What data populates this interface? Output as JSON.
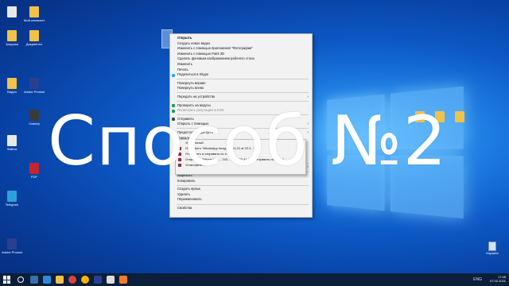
{
  "overlay_title": "Способ №2",
  "context_menu": {
    "items": [
      {
        "label": "Открыть",
        "bold": true
      },
      {
        "label": "Создать новое видео"
      },
      {
        "label": "Изменить с помощью приложения \"Фотографии\""
      },
      {
        "label": "Изменить с помощью Paint 3D"
      },
      {
        "label": "Сделать фоновым изображением рабочего стола"
      },
      {
        "label": "Изменить"
      },
      {
        "label": "Печать"
      },
      {
        "label": "Поделиться в Skype",
        "icon": "skype-icon"
      },
      {
        "sep": true
      },
      {
        "label": "Повернуть вправо"
      },
      {
        "label": "Повернуть влево"
      },
      {
        "sep": true
      },
      {
        "label": "Передать на устройство",
        "submenu": true
      },
      {
        "sep": true
      },
      {
        "label": "Проверить на вирусы",
        "icon": "kaspersky-icon"
      },
      {
        "label": "Посмотреть репутацию в KSN",
        "icon": "kaspersky-icon",
        "disabled": true
      },
      {
        "sep": true
      },
      {
        "label": "Отправить",
        "icon": "share-icon"
      },
      {
        "label": "Открыть с помощью",
        "submenu": true
      },
      {
        "sep": true
      },
      {
        "label": "Предоставить доступ к",
        "submenu": true
      },
      {
        "label": "Уникальный"
      },
      {
        "label": "Отправить"
      },
      {
        "label": "Отправить"
      },
      {
        "label": "Отправить"
      },
      {
        "label": "Отправить"
      },
      {
        "sep": true
      },
      {
        "label": "Отправить",
        "submenu": true
      },
      {
        "sep": true
      },
      {
        "label": "Вырезать"
      },
      {
        "label": "Копировать"
      },
      {
        "sep": true
      },
      {
        "label": "Создать ярлык"
      },
      {
        "label": "Удалить"
      },
      {
        "label": "Переименовать"
      },
      {
        "sep": true
      },
      {
        "label": "Свойства"
      }
    ]
  },
  "submenu": {
    "rows": [
      "Уникальный",
      "Отправить \"WhatsApp Imag... 1-01-21 at 22.4...\"",
      "Отправить и отправить по е...",
      "Отправить \"WhatsApp ... 202... 21 at 22.41.03... отправить по e-mail",
      "Установить ..."
    ]
  },
  "desktop_icons": [
    {
      "label": "",
      "color": "#e8e8e8"
    },
    {
      "label": "Мой компьютер",
      "color": "#f0c24a"
    },
    {
      "label": "Загрузки",
      "color": "#f0c24a"
    },
    {
      "label": "Документы",
      "color": "#f0c24a"
    },
    {
      "label": "Adobe Photoshop",
      "color": "#2b3f8f"
    },
    {
      "label": "Видео",
      "color": "#f0c24a"
    },
    {
      "label": "Сканер",
      "color": "#3a3a3a"
    },
    {
      "label": "Файлы",
      "color": "#e8e8e8"
    },
    {
      "label": "PDF",
      "color": "#c4262e"
    },
    {
      "label": "Telegram",
      "color": "#2aa1da"
    },
    {
      "label": "Adobe Photoshop",
      "color": "#2b3f8f"
    }
  ],
  "taskbar": {
    "time": "17:48",
    "date": "07.02.2021",
    "lang": "ENG",
    "recycle_bin_label": "Корзина"
  },
  "colors": {
    "desktop": "#0d59c6",
    "taskbar": "#0b1f3a",
    "menu_bg": "#f2f2f2"
  }
}
